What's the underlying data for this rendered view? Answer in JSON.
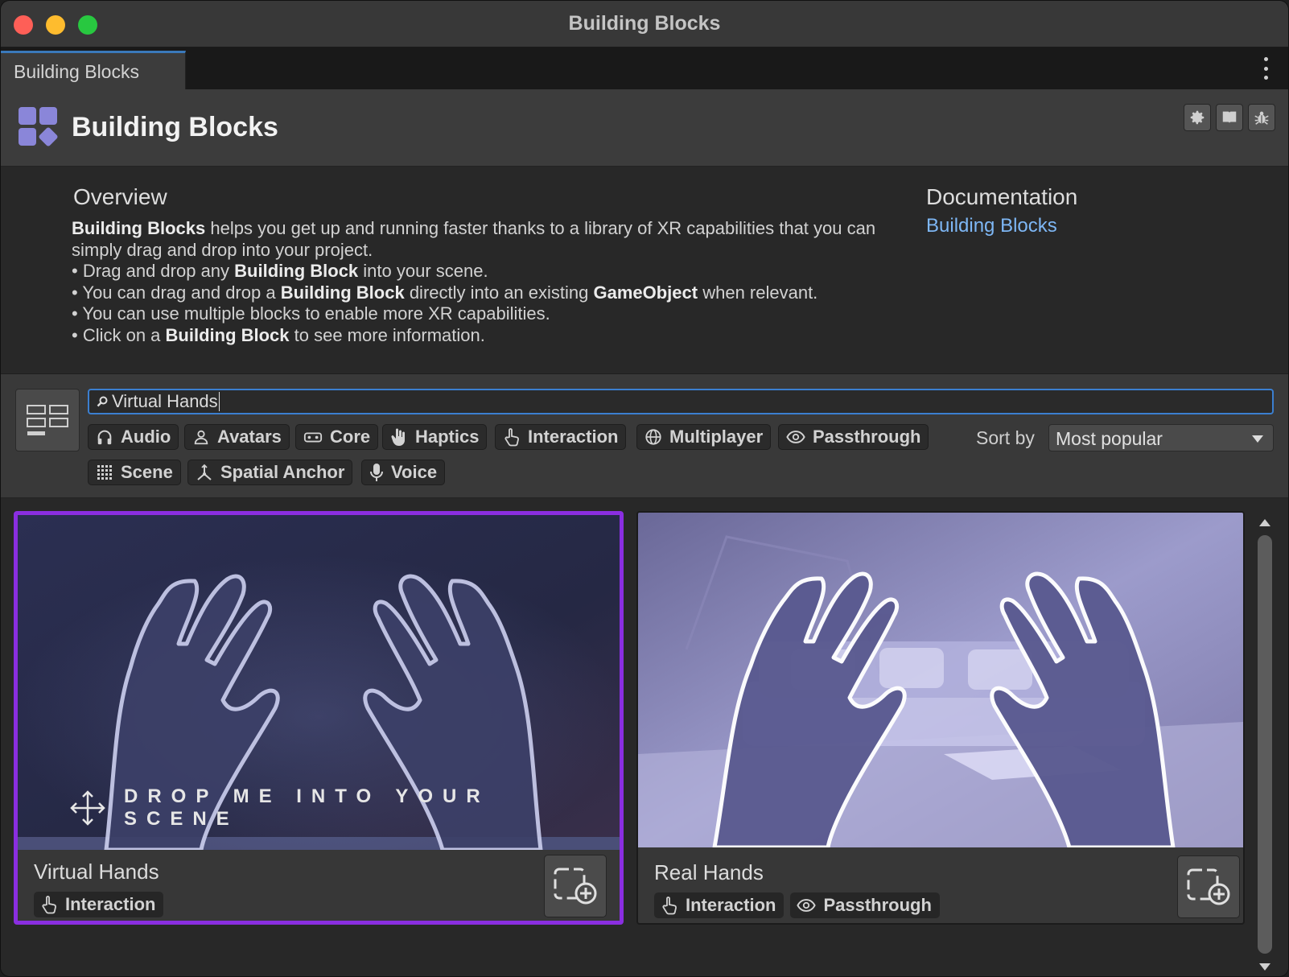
{
  "window": {
    "title": "Building Blocks"
  },
  "tab": {
    "label": "Building Blocks"
  },
  "header": {
    "title": "Building Blocks",
    "logo_color": "#8a86d9"
  },
  "overview": {
    "title": "Overview",
    "intro_bold": "Building Blocks",
    "intro_rest": " helps you get up and running faster thanks to a library of XR capabilities that you can simply drag and drop into your project.",
    "b1_pre": "• Drag and drop any ",
    "b1_bold": "Building Block",
    "b1_post": " into your scene.",
    "b2_pre": "• You can drag and drop a ",
    "b2_bold": "Building Block",
    "b2_mid": " directly into an existing ",
    "b2_bold2": "GameObject",
    "b2_post": " when relevant.",
    "b3": "• You can use multiple blocks to enable more XR capabilities.",
    "b4_pre": "• Click on a ",
    "b4_bold": "Building Block",
    "b4_post": " to see more information."
  },
  "documentation": {
    "title": "Documentation",
    "link": "Building Blocks",
    "link_color": "#7eb7f5"
  },
  "search": {
    "value": "Virtual Hands"
  },
  "filters": {
    "chips": [
      {
        "label": "Audio",
        "icon": "headphones-icon"
      },
      {
        "label": "Avatars",
        "icon": "person-icon"
      },
      {
        "label": "Core",
        "icon": "headset-icon"
      },
      {
        "label": "Haptics",
        "icon": "hand-icon"
      },
      {
        "label": "Interaction",
        "icon": "pointer-hand-icon"
      },
      {
        "label": "Multiplayer",
        "icon": "globe-icon"
      },
      {
        "label": "Passthrough",
        "icon": "eye-icon"
      },
      {
        "label": "Scene",
        "icon": "grid-dots-icon"
      },
      {
        "label": "Spatial Anchor",
        "icon": "anchor-axes-icon"
      },
      {
        "label": "Voice",
        "icon": "microphone-icon"
      }
    ],
    "sort_label": "Sort by",
    "sort_value": "Most popular"
  },
  "cards": [
    {
      "name": "Virtual Hands",
      "selected": true,
      "overlay_text": "DROP ME INTO YOUR SCENE",
      "tags": [
        "Interaction"
      ]
    },
    {
      "name": "Real Hands",
      "selected": false,
      "tags": [
        "Interaction",
        "Passthrough"
      ]
    }
  ],
  "colors": {
    "selection": "#8a2ee0",
    "search_focus": "#3b7fd0"
  }
}
